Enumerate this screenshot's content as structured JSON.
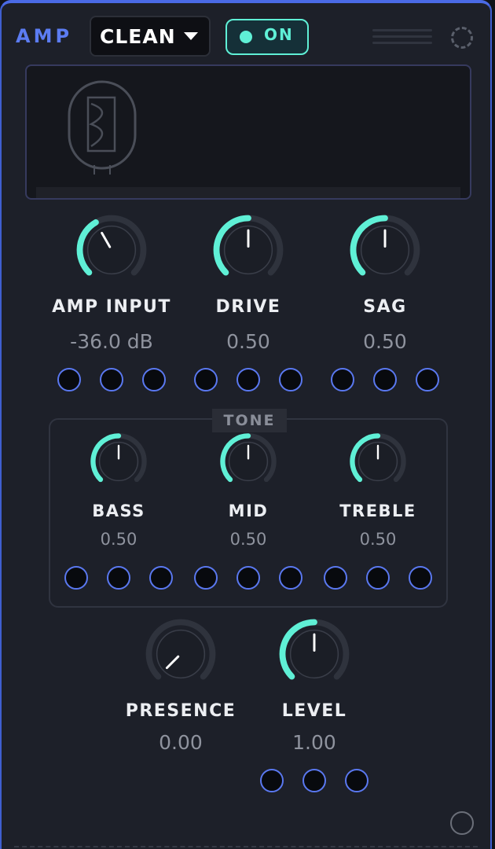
{
  "header": {
    "title": "AMP",
    "preset": {
      "value": "CLEAN"
    },
    "power": {
      "label": "ON",
      "state": "on"
    }
  },
  "colors": {
    "accent": "#5ff0d6",
    "panel": "#1d2029",
    "port_ring": "#5a78f0",
    "title_blue": "#5c7cf2"
  },
  "display": {
    "icon": "tube-icon"
  },
  "main_knobs": [
    {
      "id": "amp-input",
      "label": "AMP INPUT",
      "value": "-36.0 dB",
      "level": 0.39
    },
    {
      "id": "drive",
      "label": "DRIVE",
      "value": "0.50",
      "level": 0.5
    },
    {
      "id": "sag",
      "label": "SAG",
      "value": "0.50",
      "level": 0.5
    }
  ],
  "tone": {
    "title": "TONE",
    "knobs": [
      {
        "id": "bass",
        "label": "BASS",
        "value": "0.50",
        "level": 0.5
      },
      {
        "id": "mid",
        "label": "MID",
        "value": "0.50",
        "level": 0.5
      },
      {
        "id": "treble",
        "label": "TREBLE",
        "value": "0.50",
        "level": 0.5
      }
    ]
  },
  "output_knobs": [
    {
      "id": "presence",
      "label": "PRESENCE",
      "value": "0.00",
      "level": 0.0
    },
    {
      "id": "level",
      "label": "LEVEL",
      "value": "1.00",
      "level": 0.5
    }
  ]
}
